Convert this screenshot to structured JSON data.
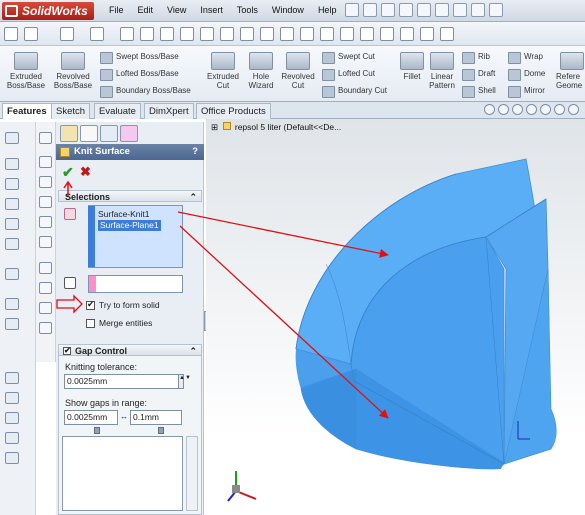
{
  "app": {
    "logo_text": "SolidWorks"
  },
  "menu": [
    "File",
    "Edit",
    "View",
    "Insert",
    "Tools",
    "Window",
    "Help"
  ],
  "ribbon": {
    "extruded_boss": "Extruded Boss/Base",
    "revolved_boss": "Revolved Boss/Base",
    "swept_boss": "Swept Boss/Base",
    "lofted_boss": "Lofted Boss/Base",
    "boundary_boss": "Boundary Boss/Base",
    "extruded_cut": "Extruded Cut",
    "hole_wizard": "Hole Wizard",
    "revolved_cut": "Revolved Cut",
    "swept_cut": "Swept Cut",
    "lofted_cut": "Lofted Cut",
    "boundary_cut": "Boundary Cut",
    "fillet": "Fillet",
    "linear_pattern": "Linear Pattern",
    "rib": "Rib",
    "draft": "Draft",
    "shell": "Shell",
    "wrap": "Wrap",
    "dome": "Dome",
    "mirror": "Mirror",
    "reference": "Refere Geome"
  },
  "tabs": [
    "Features",
    "Sketch",
    "Evaluate",
    "DimXpert",
    "Office Products"
  ],
  "property_manager": {
    "title": "Knit Surface",
    "help": "?",
    "selections_header": "Selections",
    "selections": [
      "Surface-Knit1",
      "Surface-Plane1"
    ],
    "try_form_solid": "Try to form solid",
    "merge_entities": "Merge entities",
    "gap_control_header": "Gap Control",
    "knitting_tolerance_label": "Knitting tolerance:",
    "knitting_tolerance": "0.0025mm",
    "show_gaps_label": "Show gaps in range:",
    "gap_min": "0.0025mm",
    "gap_max": "0.1mm",
    "try_form_solid_checked": true,
    "merge_entities_checked": false
  },
  "viewport": {
    "tree_label": "repsol 5 liter  (Default<<De..."
  },
  "colors": {
    "model": "#4ea4f2",
    "model_dark": "#2f86d8",
    "annotation": "#e01010",
    "pm_header": "#4c6690"
  }
}
